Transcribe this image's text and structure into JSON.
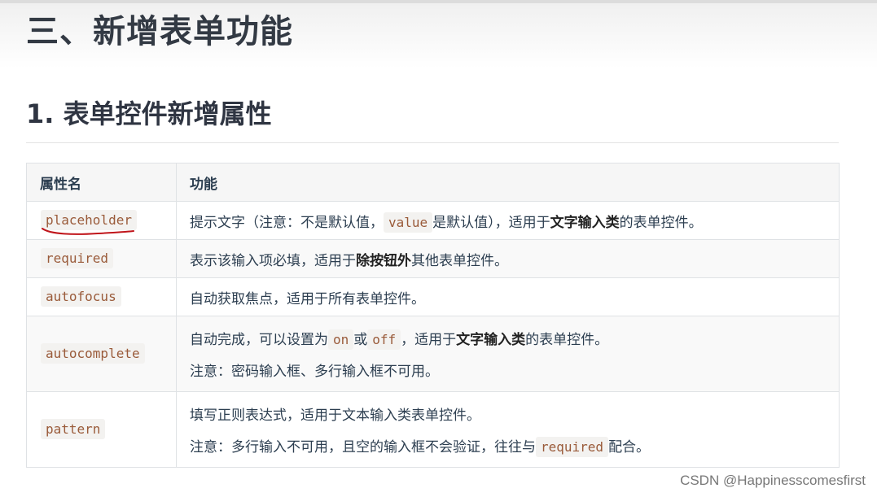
{
  "heading_main": "三、新增表单功能",
  "heading_sub": "1. 表单控件新增属性",
  "table": {
    "headers": [
      "属性名",
      "功能"
    ],
    "rows": [
      {
        "attr": "placeholder",
        "line1": {
          "t1": "提示文字（注意：不是默认值，",
          "code1": "value",
          "t2": "是默认值），适用于",
          "bold": "文字输入类",
          "t3": "的表单控件。"
        }
      },
      {
        "attr": "required",
        "line1": {
          "t1": "表示该输入项必填，适用于",
          "bold": "除按钮外",
          "t2": "其他表单控件。"
        }
      },
      {
        "attr": "autofocus",
        "line1": {
          "t1": "自动获取焦点，适用于所有表单控件。"
        }
      },
      {
        "attr": "autocomplete",
        "line1": {
          "t1": "自动完成，可以设置为",
          "code1": "on",
          "t2": "或",
          "code2": "off",
          "t3": "，适用于",
          "bold": "文字输入类",
          "t4": "的表单控件。"
        },
        "line2": {
          "t1": "注意：密码输入框、多行输入框不可用。"
        }
      },
      {
        "attr": "pattern",
        "line1": {
          "t1": "填写正则表达式，适用于文本输入类表单控件。"
        },
        "line2": {
          "t1": "注意：多行输入不可用，且空的输入框不会验证，往往与",
          "code1": "required",
          "t2": "配合。"
        }
      }
    ]
  },
  "watermark": "CSDN @Happinesscomesfirst",
  "annotation_color": "#c0151b"
}
